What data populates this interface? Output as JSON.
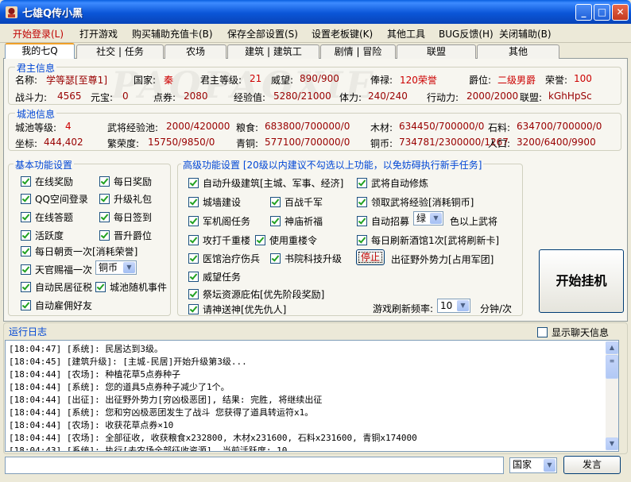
{
  "window": {
    "title": "七雄Q传小黑"
  },
  "menu": [
    "开始登录(L)",
    "打开游戏",
    "购买辅助充值卡(B)",
    "保存全部设置(S)",
    "设置老板键(K)",
    "其他工具",
    "BUG反馈(H)",
    "关闭辅助(B)"
  ],
  "tabs": [
    "我的七Q",
    "社交 | 任务",
    "农场",
    "建筑 | 建筑工",
    "剧情 | 冒险",
    "联盟",
    "其他"
  ],
  "watermark": "PAOPAOXIE",
  "lord": {
    "title": "君主信息",
    "name_label": "名称:",
    "name": "学等瑟[至尊1]",
    "country_label": "国家:",
    "country": "秦",
    "level_label": "君主等级:",
    "level": "21",
    "prestige_label": "威望:",
    "prestige": "890/900",
    "salary_label": "俸禄:",
    "salary": "120荣誉",
    "rank_label": "爵位:",
    "rank": "二级男爵",
    "honor_label": "荣誉:",
    "honor": "100",
    "power_label": "战斗力:",
    "power": "4565",
    "yuanbao_label": "元宝:",
    "yuanbao": "0",
    "coupon_label": "点券:",
    "coupon": "2080",
    "exp_label": "经验值:",
    "exp": "5280/21000",
    "stamina_label": "体力:",
    "stamina": "240/240",
    "action_label": "行动力:",
    "action": "2000/2000",
    "alliance_label": "联盟:",
    "alliance": "kGhHpSc"
  },
  "city": {
    "title": "城池信息",
    "level_label": "城池等级:",
    "level": "4",
    "pool_label": "武将经验池:",
    "pool": "2000/420000",
    "grain_label": "粮食:",
    "grain": "683800/700000/0",
    "wood_label": "木材:",
    "wood": "634450/700000/0",
    "stone_label": "石料:",
    "stone": "634700/700000/0",
    "coord_label": "坐标:",
    "coord": "444,402",
    "prosperity_label": "繁荣度:",
    "prosperity": "15750/9850/0",
    "bronze_label": "青铜:",
    "bronze": "577100/700000/0",
    "copper_label": "铜币:",
    "copper": "734781/2300000/1267",
    "population_label": "人口:",
    "population": "3200/6400/9900"
  },
  "basic": {
    "title": "基本功能设置",
    "online_reward": "在线奖励",
    "daily_reward": "每日奖励",
    "qq_login": "QQ空间登录",
    "upgrade_gift": "升级礼包",
    "online_quiz": "在线答题",
    "daily_signin": "每日签到",
    "activity": "活跃度",
    "promote_rank": "晋升爵位",
    "daily_tribute": "每日朝贡一次[消耗荣誉]",
    "blessing": "天官赐福一次",
    "blessing_option": "铜币",
    "tax": "自动民居征税",
    "city_event": "城池随机事件",
    "hire_friend": "自动雇佣好友"
  },
  "advanced": {
    "title": "高级功能设置",
    "note": "[20级以内建议不勾选以上功能，以免妨碍执行新手任务]",
    "auto_build": "自动升级建筑[主城、军事、经济]",
    "auto_cultivate": "武将自动修炼",
    "city_build": "城墙建设",
    "hundred_war": "百战千军",
    "general_exp": "领取武将经验[消耗铜币]",
    "army_task": "军机阁任务",
    "temple": "神庙祈福",
    "auto_recruit": "自动招募",
    "recruit_color": "绿",
    "recruit_suffix": "色以上武将",
    "attack_tower": "攻打千重楼",
    "use_tower_token": "使用重楼令",
    "refresh_tavern": "每日刷新酒馆1次[武将刷新卡]",
    "heal": "医馆治疗伤兵",
    "academy": "书院科技升级",
    "stop_button": "停止",
    "expedition": "出征野外势力[占用军团]",
    "prestige_task": "威望任务",
    "altar": "祭坛资源庇佑[优先阶段奖励]",
    "invite_god": "请神送神[优先仇人]",
    "refresh_label": "游戏刷新频率:",
    "refresh_value": "10",
    "refresh_unit": "分钟/次",
    "start_button": "开始挂机"
  },
  "log": {
    "title": "运行日志",
    "show_chat": "显示聊天信息",
    "lines": [
      "[18:04:47] [系统]: 民居达到3级。",
      "[18:04:45] [建筑升级]: [主城-民居]开始升级第3级...",
      "[18:04:44] [农场]: 种植花草5点券种子",
      "[18:04:44] [系统]: 您的道具5点券种子减少了1个。",
      "[18:04:44] [出征]: 出征野外势力[穷凶极恶团], 结果: 完胜, 将继续出征",
      "[18:04:44] [系统]: 您和穷凶极恶团发生了战斗 您获得了道具转运符x1。",
      "[18:04:44] [农场]: 收获花草点券×10",
      "[18:04:44] [农场]: 全部征收, 收获粮食x232800, 木材x231600, 石料x231600, 青铜x174000",
      "[18:04:43] [系统]: 执行[去农场全部征收资源], 当前活跃度: 10。"
    ]
  },
  "chat": {
    "channel": "国家",
    "send_button": "发言"
  },
  "colors": {
    "title_blue": "#0B56D8",
    "value_red": "#990000",
    "group_blue": "#0046D5"
  }
}
